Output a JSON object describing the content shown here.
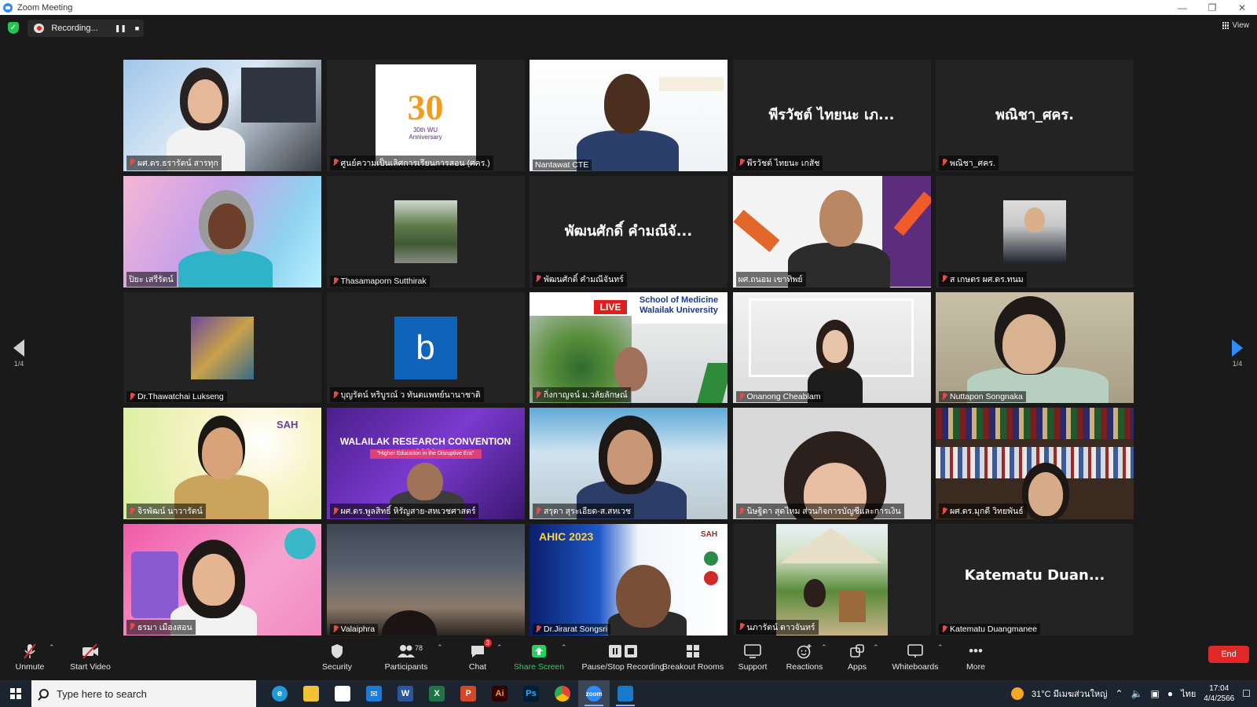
{
  "window": {
    "title": "Zoom Meeting"
  },
  "top": {
    "recording_label": "Recording...",
    "view_label": "View"
  },
  "pager": {
    "page": "1/4"
  },
  "tiles": [
    {
      "name": "ผศ.ดร.ธรารัตน์ สารทุก",
      "video": true
    },
    {
      "name": "ศูนย์ความเป็นเลิศการเรียนการสอน (ศคร.)",
      "video": true
    },
    {
      "name": "Nantawat CTE",
      "video": true,
      "active": true
    },
    {
      "name": "พีรวัชต์ ไทยนะ เกสัช",
      "display": "พีรวัชต์ ไทยนะ เภ...",
      "video": false
    },
    {
      "name": "พณิชา_ศคร.",
      "display": "พณิชา_ศคร.",
      "video": false
    },
    {
      "name": "ปิยะ เสรีรัตน์",
      "video": true
    },
    {
      "name": "Thasamaporn Sutthirak",
      "video": true
    },
    {
      "name": "พัฒนศักดิ์ คำมณีจันทร์",
      "display": "พัฒนศักดิ์ คำมณีจั...",
      "video": false
    },
    {
      "name": "ผศ.ถนอม เขาทิพย์",
      "video": true
    },
    {
      "name": "ส เกษตร ผศ.ดร.ทนม",
      "video": true
    },
    {
      "name": "Dr.Thawatchai Lukseng",
      "video": true
    },
    {
      "name": "บุญรัตน์ หริบูรณ์ ว ทันตแพทย์นานาชาติ",
      "video": true
    },
    {
      "name": "กิ่งกาญจน์ ม.วลัยลักษณ์",
      "video": true
    },
    {
      "name": "Onanong Cheablam",
      "video": true
    },
    {
      "name": "Nuttapon Songnaka",
      "video": true
    },
    {
      "name": "จิรพัฒน์ นาวารัตน์",
      "video": true
    },
    {
      "name": "ผศ.ดร.พูลสิทธิ์ หิรัญสาย-สหเวชศาสตร์",
      "video": true
    },
    {
      "name": "สรุดา สุระเอียด-ส.สหเวช",
      "video": true
    },
    {
      "name": "นิษฐิดา สุดไหม ส่วนกิจการบัญชีและการเงิน",
      "video": true
    },
    {
      "name": "ผศ.ดร.มุกดี วิทยพันธ์",
      "video": true
    },
    {
      "name": "ธรมา เมืองสอน",
      "video": true
    },
    {
      "name": "Valaiphra",
      "video": true
    },
    {
      "name": "Dr.Jirarat Songsri",
      "video": true
    },
    {
      "name": "นภารัตน์ ดาวจันทร์",
      "video": true
    },
    {
      "name": "Katematu Duangmanee",
      "display": "Katematu Duan...",
      "video": false
    }
  ],
  "slides": {
    "wu30": "30th WU Anniversary",
    "b_letter": "b",
    "live": "LIVE",
    "som_title": "School of Medicine",
    "som_sub": "Walailak University",
    "wrc_title": "WALAILAK RESEARCH CONVENTION 2023",
    "wrc_sub": "\"Higher Education in the Disruptive Era\"",
    "ahic_title": "AHIC 2023",
    "sah": "SAH"
  },
  "toolbar": {
    "unmute": "Unmute",
    "start_video": "Start Video",
    "security": "Security",
    "participants": "Participants",
    "participants_count": "78",
    "chat": "Chat",
    "chat_badge": "3",
    "share_screen": "Share Screen",
    "pause_stop_recording": "Pause/Stop Recording",
    "breakout_rooms": "Breakout Rooms",
    "support": "Support",
    "reactions": "Reactions",
    "apps": "Apps",
    "whiteboards": "Whiteboards",
    "more": "More",
    "end": "End"
  },
  "taskbar": {
    "search_placeholder": "Type here to search",
    "weather": "31°C มีเมฆส่วนใหญ่",
    "lang": "ไทย",
    "time": "17:04",
    "date": "4/4/2566",
    "apps": [
      "edge",
      "file-explorer",
      "store",
      "mail",
      "word",
      "excel",
      "powerpoint",
      "illustrator",
      "photoshop",
      "chrome",
      "zoom",
      "photos"
    ]
  },
  "colors": {
    "accent": "#2d8cff",
    "end": "#e02828",
    "active_speaker": "#d2e86a",
    "share_green": "#23d160"
  }
}
